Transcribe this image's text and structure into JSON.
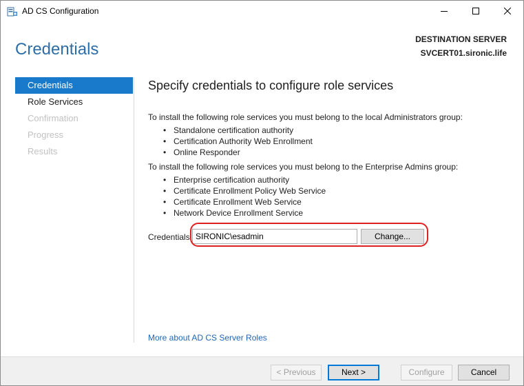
{
  "window": {
    "title": "AD CS Configuration",
    "icons": {
      "app": "server-cert-icon",
      "minimize": "minimize-icon",
      "maximize": "maximize-icon",
      "close": "close-icon"
    }
  },
  "header": {
    "page_title": "Credentials",
    "destination_label": "DESTINATION SERVER",
    "destination_server": "SVCERT01.sironic.life"
  },
  "sidebar": {
    "items": [
      {
        "label": "Credentials",
        "state": "active"
      },
      {
        "label": "Role Services",
        "state": "enabled"
      },
      {
        "label": "Confirmation",
        "state": "disabled"
      },
      {
        "label": "Progress",
        "state": "disabled"
      },
      {
        "label": "Results",
        "state": "disabled"
      }
    ]
  },
  "main": {
    "title": "Specify credentials to configure role services",
    "local_admins_text": "To install the following role services you must belong to the local Administrators group:",
    "local_admin_services": [
      "Standalone certification authority",
      "Certification Authority Web Enrollment",
      "Online Responder"
    ],
    "enterprise_admins_text": "To install the following role services you must belong to the Enterprise Admins group:",
    "enterprise_admin_services": [
      "Enterprise certification authority",
      "Certificate Enrollment Policy Web Service",
      "Certificate Enrollment Web Service",
      "Network Device Enrollment Service"
    ],
    "credentials_label": "Credentials:",
    "credentials_value": "SIRONIC\\esadmin",
    "change_button": "Change...",
    "more_link": "More about AD CS Server Roles"
  },
  "footer": {
    "previous": "< Previous",
    "next": "Next >",
    "configure": "Configure",
    "cancel": "Cancel"
  },
  "colors": {
    "accent": "#1979ca",
    "heading": "#2e6ea8",
    "link": "#1e65b5",
    "highlight": "#e02020"
  }
}
